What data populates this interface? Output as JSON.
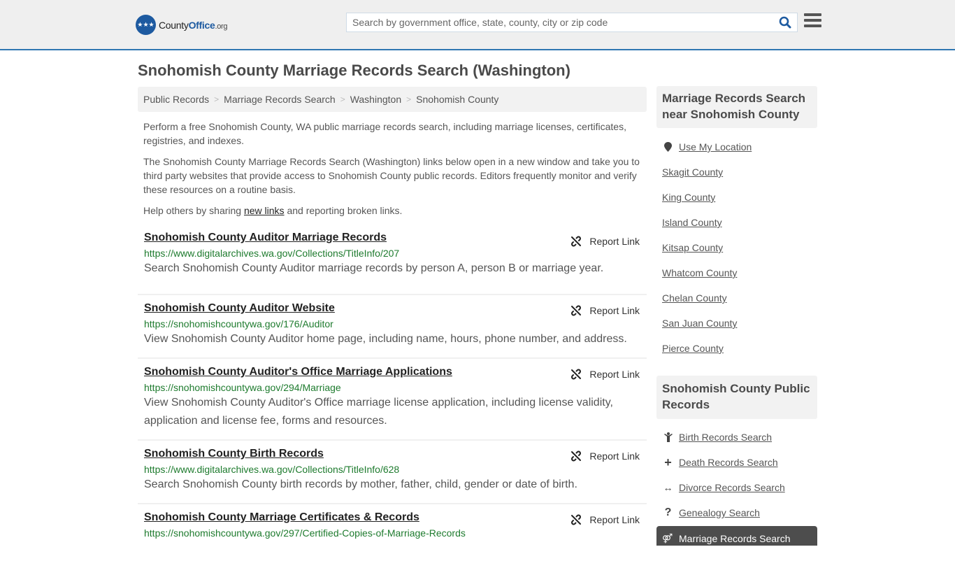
{
  "header": {
    "logo": {
      "name_part1": "County",
      "name_part2": "Office",
      "name_part3": ".org"
    },
    "search": {
      "placeholder": "Search by government office, state, county, city or zip code",
      "value": ""
    },
    "icons": {
      "search": "search-icon",
      "menu": "hamburger-menu-icon"
    }
  },
  "page": {
    "title": "Snohomish County Marriage Records Search (Washington)"
  },
  "breadcrumb": [
    {
      "label": "Public Records"
    },
    {
      "label": "Marriage Records Search"
    },
    {
      "label": "Washington"
    },
    {
      "label": "Snohomish County"
    }
  ],
  "intro": {
    "p1": "Perform a free Snohomish County, WA public marriage records search, including marriage licenses, certificates, registries, and indexes.",
    "p2": "The Snohomish County Marriage Records Search (Washington) links below open in a new window and take you to third party websites that provide access to Snohomish County public records. Editors frequently monitor and verify these resources on a routine basis.",
    "p3_before": "Help others by sharing ",
    "p3_link": "new links",
    "p3_after": " and reporting broken links."
  },
  "report_label": "Report Link",
  "results": [
    {
      "title": "Snohomish County Auditor Marriage Records",
      "url": "https://www.digitalarchives.wa.gov/Collections/TitleInfo/207",
      "desc": "Search Snohomish County Auditor marriage records by person A, person B or marriage year."
    },
    {
      "title": "Snohomish County Auditor Website",
      "url": "https://snohomishcountywa.gov/176/Auditor",
      "desc": "View Snohomish County Auditor home page, including name, hours, phone number, and address."
    },
    {
      "title": "Snohomish County Auditor's Office Marriage Applications",
      "url": "https://snohomishcountywa.gov/294/Marriage",
      "desc": "View Snohomish County Auditor's Office marriage license application, including license validity, application and license fee, forms and resources."
    },
    {
      "title": "Snohomish County Birth Records",
      "url": "https://www.digitalarchives.wa.gov/Collections/TitleInfo/628",
      "desc": "Search Snohomish County birth records by mother, father, child, gender or date of birth."
    },
    {
      "title": "Snohomish County Marriage Certificates & Records",
      "url": "https://snohomishcountywa.gov/297/Certified-Copies-of-Marriage-Records",
      "desc": ""
    }
  ],
  "sidebar": {
    "nearby": {
      "heading": "Marriage Records Search near Snohomish County",
      "use_location": "Use My Location",
      "counties": [
        "Skagit County",
        "King County",
        "Island County",
        "Kitsap County",
        "Whatcom County",
        "Chelan County",
        "San Juan County",
        "Pierce County"
      ]
    },
    "public_records": {
      "heading": "Snohomish County Public Records",
      "items": [
        {
          "label": "Birth Records Search",
          "icon": "child-icon"
        },
        {
          "label": "Death Records Search",
          "icon": "plus-icon"
        },
        {
          "label": "Divorce Records Search",
          "icon": "arrows-horizontal-icon"
        },
        {
          "label": "Genealogy Search",
          "icon": "question-icon"
        }
      ],
      "active": {
        "label": "Marriage Records Search",
        "icon": "marriage-icon"
      }
    }
  },
  "colors": {
    "accent": "#2f77b1",
    "brand": "#1d5aa0",
    "url_green": "#1e7b2e",
    "active_bg": "#4d4d4d"
  }
}
